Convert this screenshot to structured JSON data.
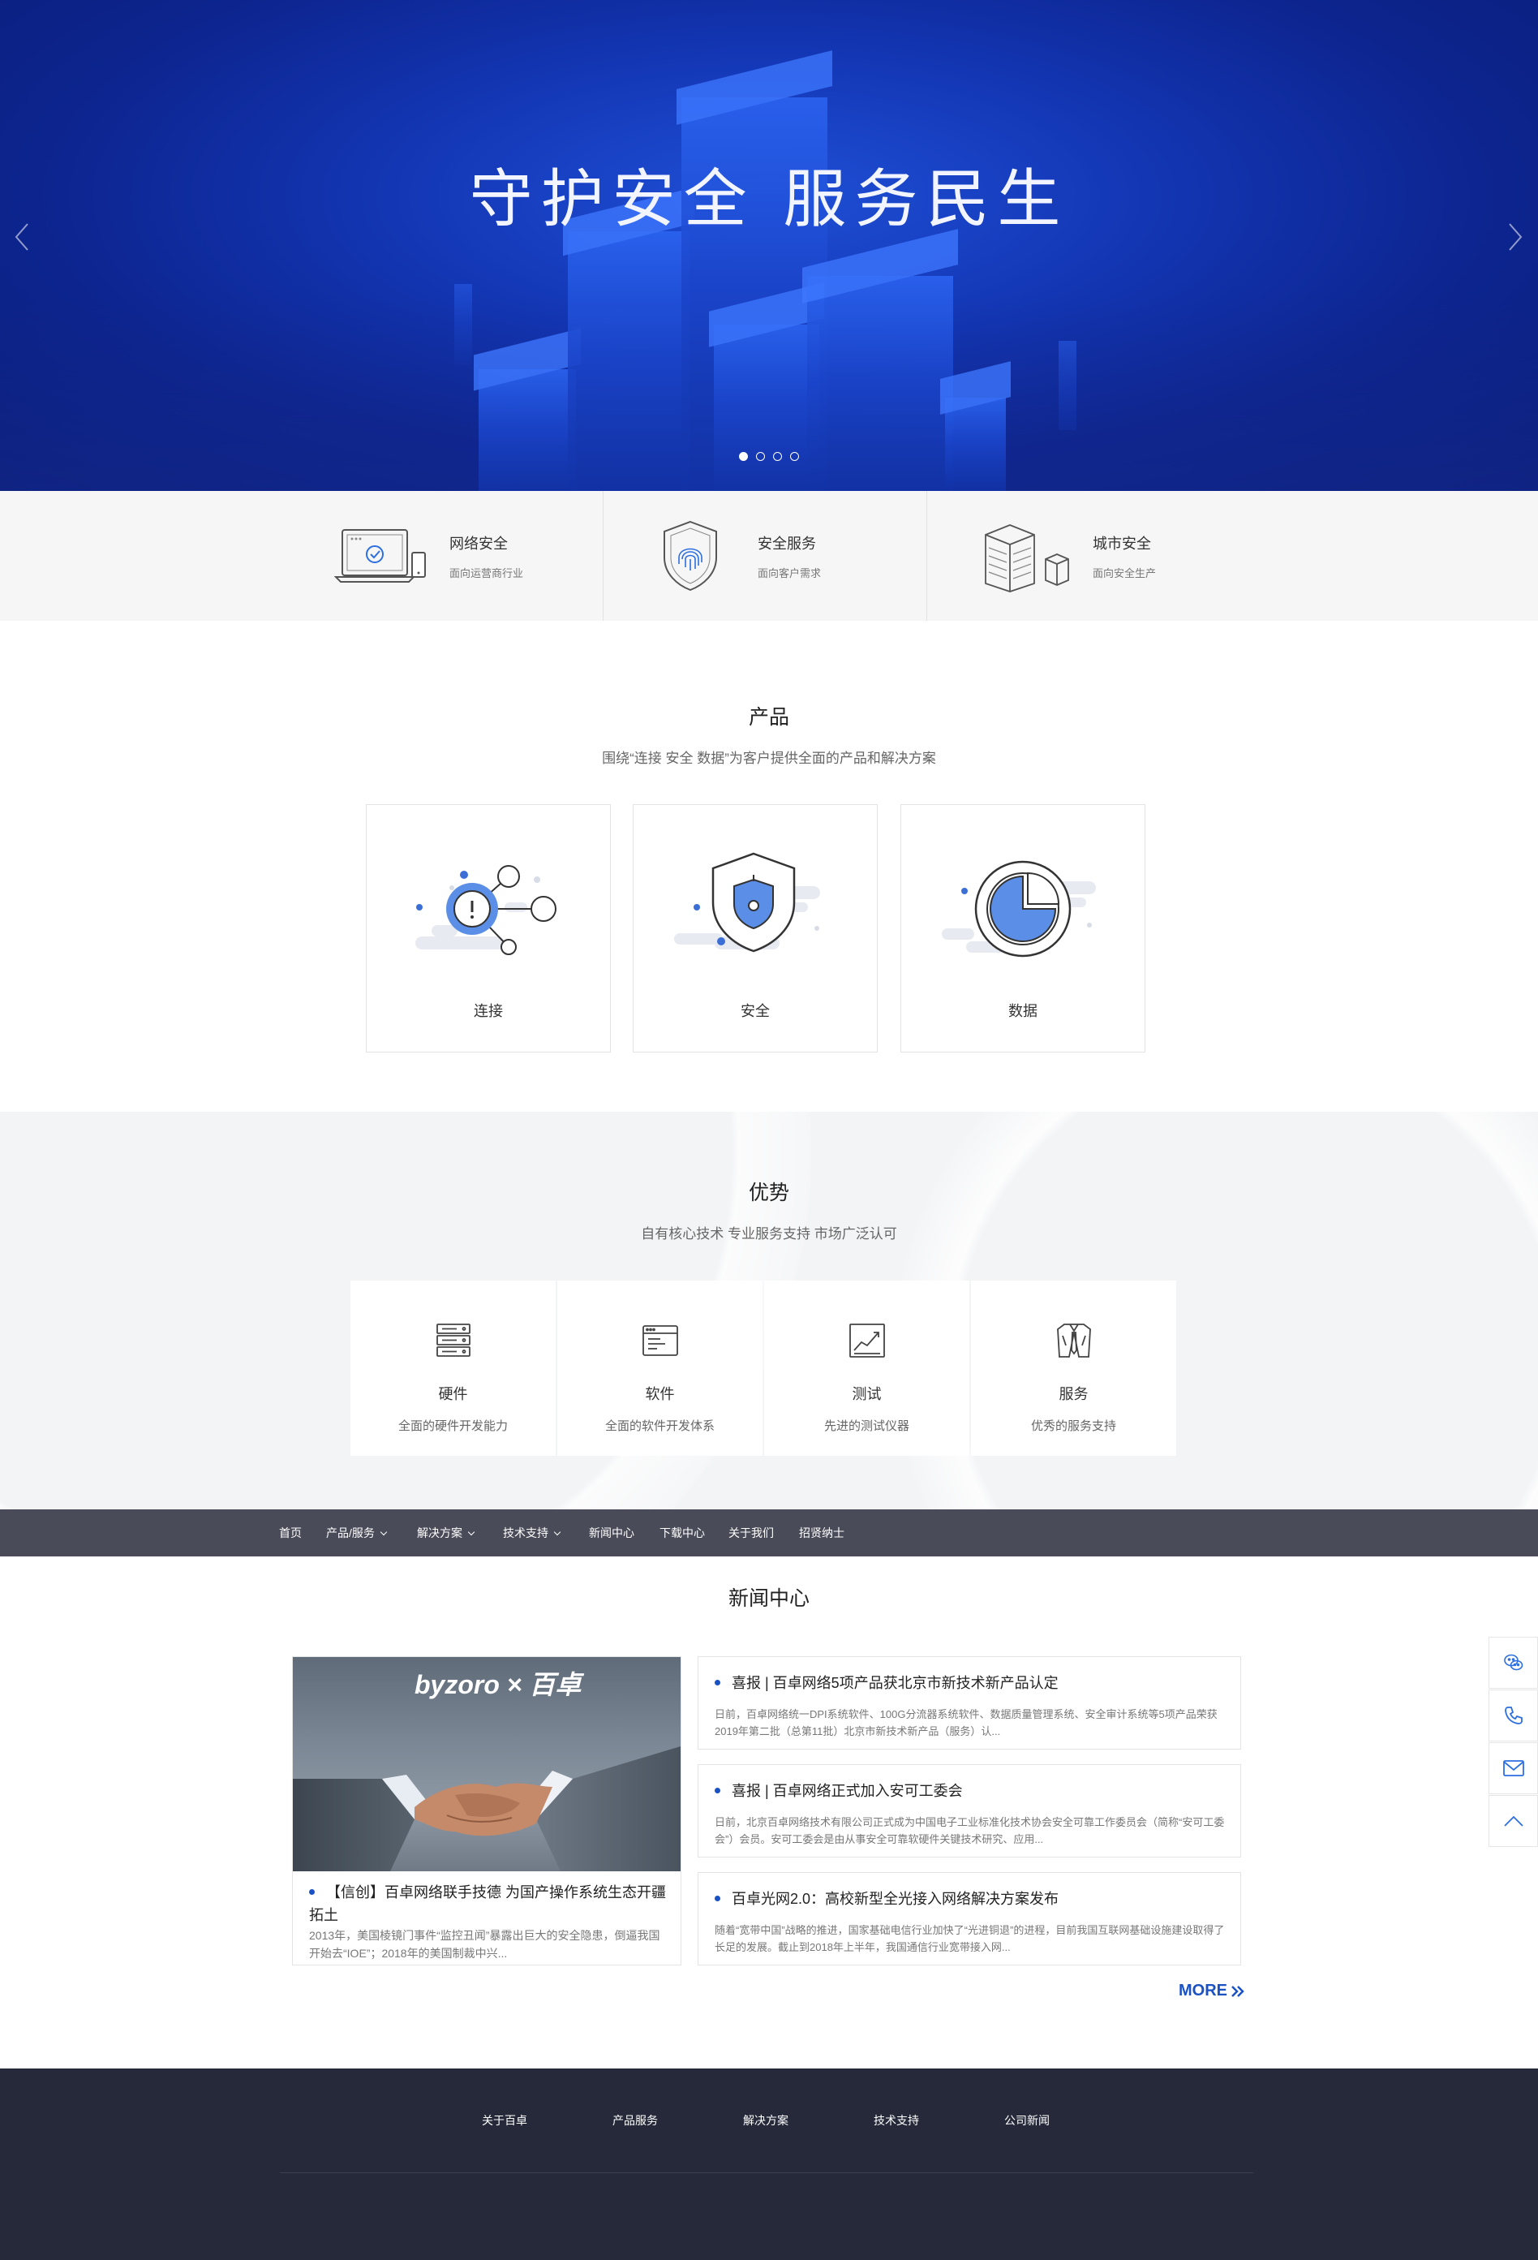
{
  "hero": {
    "title": "守护安全  服务民生",
    "slides": 4,
    "active_slide": 1
  },
  "features": [
    {
      "title": "网络安全",
      "subtitle": "面向运营商行业",
      "icon": "laptop-check-icon"
    },
    {
      "title": "安全服务",
      "subtitle": "面向客户需求",
      "icon": "fingerprint-shield-icon"
    },
    {
      "title": "城市安全",
      "subtitle": "面向安全生产",
      "icon": "server-rack-icon"
    }
  ],
  "products": {
    "title": "产品",
    "subtitle": "围绕“连接 安全 数据”为客户提供全面的产品和解决方案",
    "items": [
      {
        "label": "连接",
        "icon": "network-node-icon"
      },
      {
        "label": "安全",
        "icon": "shield-icon"
      },
      {
        "label": "数据",
        "icon": "pie-chart-icon"
      }
    ]
  },
  "advantages": {
    "title": "优势",
    "subtitle": "自有核心技术 专业服务支持 市场广泛认可",
    "items": [
      {
        "title": "硬件",
        "subtitle": "全面的硬件开发能力",
        "icon": "server-icon"
      },
      {
        "title": "软件",
        "subtitle": "全面的软件开发体系",
        "icon": "browser-window-icon"
      },
      {
        "title": "测试",
        "subtitle": "先进的测试仪器",
        "icon": "line-chart-icon"
      },
      {
        "title": "服务",
        "subtitle": "优秀的服务支持",
        "icon": "suit-tie-icon"
      }
    ]
  },
  "nav": {
    "items": [
      "首页",
      "产品/服务",
      "解决方案",
      "技术支持",
      "新闻中心",
      "下载中心",
      "关于我们",
      "招贤纳士"
    ],
    "has_dropdown": [
      false,
      true,
      true,
      true,
      false,
      false,
      false,
      false
    ]
  },
  "news": {
    "title": "新闻中心",
    "feature": {
      "image_text": "byzoro × 百卓",
      "title": "【信创】百卓网络联手技德 为国产操作系统生态开疆拓土",
      "desc": "2013年，美国棱镜门事件“监控丑闻”暴露出巨大的安全隐患，倒逼我国开始去“IOE”；2018年的美国制裁中兴..."
    },
    "items": [
      {
        "title": "喜报 | 百卓网络5项产品获北京市新技术新产品认定",
        "desc": "日前，百卓网络统一DPI系统软件、100G分流器系统软件、数据质量管理系统、安全审计系统等5项产品荣获2019年第二批（总第11批）北京市新技术新产品（服务）认..."
      },
      {
        "title": "喜报 | 百卓网络正式加入安可工委会",
        "desc": "日前，北京百卓网络技术有限公司正式成为中国电子工业标准化技术协会安全可靠工作委员会（简称“安可工委会”）会员。安可工委会是由从事安全可靠软硬件关键技术研究、应用..."
      },
      {
        "title": "百卓光网2.0：高校新型全光接入网络解决方案发布",
        "desc": "随着“宽带中国”战略的推进，国家基础电信行业加快了“光进铜退”的进程，目前我国互联网基础设施建设取得了长足的发展。截止到2018年上半年，我国通信行业宽带接入网..."
      }
    ],
    "more_label": "MORE"
  },
  "side_tools": [
    {
      "name": "wechat-icon"
    },
    {
      "name": "phone-icon"
    },
    {
      "name": "mail-icon"
    },
    {
      "name": "back-to-top-icon"
    }
  ],
  "footer": {
    "links": [
      "关于百卓",
      "产品服务",
      "解决方案",
      "技术支持",
      "公司新闻"
    ]
  },
  "colors": {
    "hero_blue": "#1336b4",
    "accent": "#1a52c4",
    "nav_bg": "#4a4b58",
    "footer_bg": "#252939",
    "icon_blue": "#5b8ee6"
  }
}
